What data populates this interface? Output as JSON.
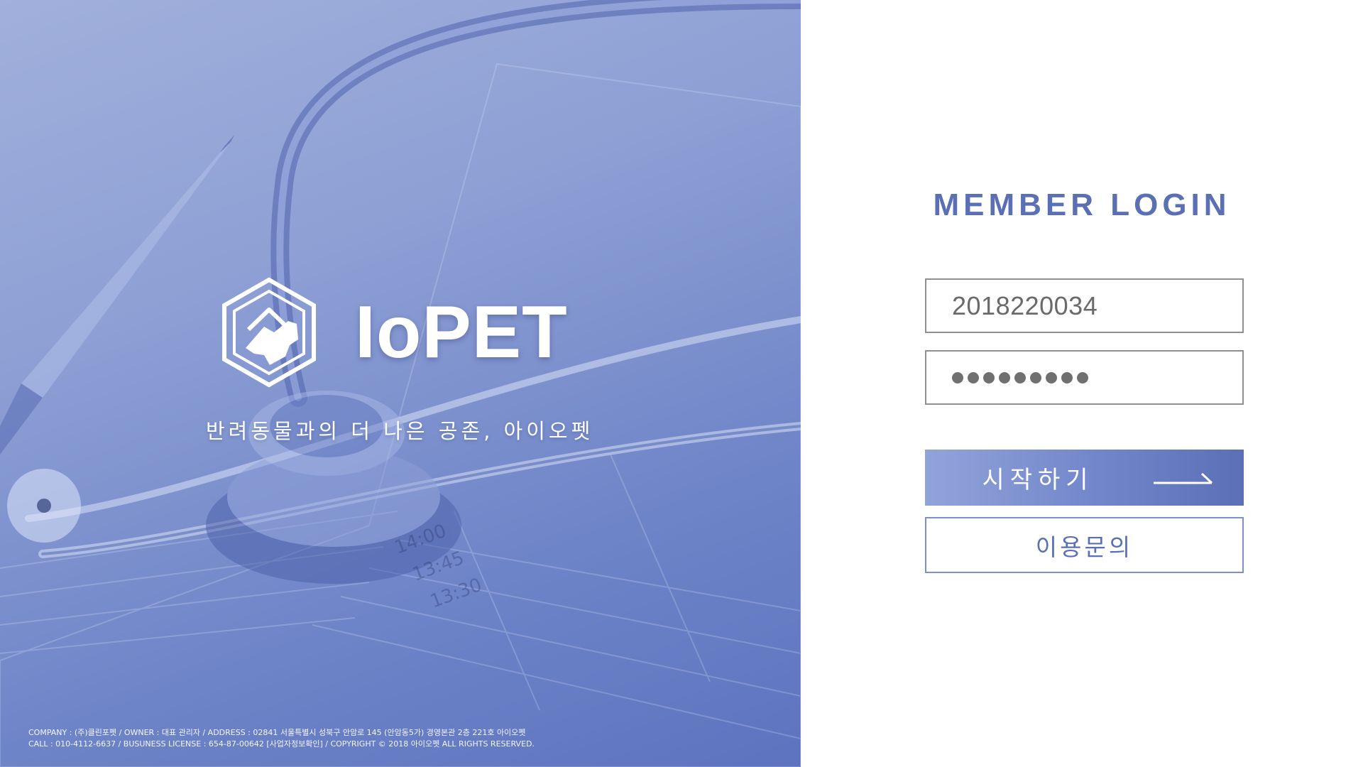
{
  "brand": {
    "name": "IoPET",
    "tagline": "반려동물과의 더 나은 공존, 아이오펫",
    "logo_icon": "hexagon-pet-logo-icon"
  },
  "footer": {
    "line1": "COMPANY : (주)클린포펫 /  OWNER : 대표 관리자 /  ADDRESS : 02841 서울특별시 성북구 안암로 145 (안암동5가) 경영본관 2층 221호 아이오펫",
    "line2": "CALL : 010-4112-6637 /  BUSUNESS LICENSE : 654-87-00642 [사업자정보확인] /  COPYRIGHT © 2018 아이오펫 ALL RIGHTS RESERVED."
  },
  "login": {
    "title": "MEMBER LOGIN",
    "id_value": "2018220034",
    "password_masked_length": 9,
    "start_button_label": "시작하기",
    "start_button_icon": "arrow-right-icon",
    "inquiry_button_label": "이용문의"
  },
  "colors": {
    "accent": "#5b6fb5",
    "hero_gradient_start": "#a1b0dc",
    "hero_gradient_end": "#5d73bf",
    "field_border": "#8f8f8f",
    "field_text": "#6a6a6a"
  }
}
